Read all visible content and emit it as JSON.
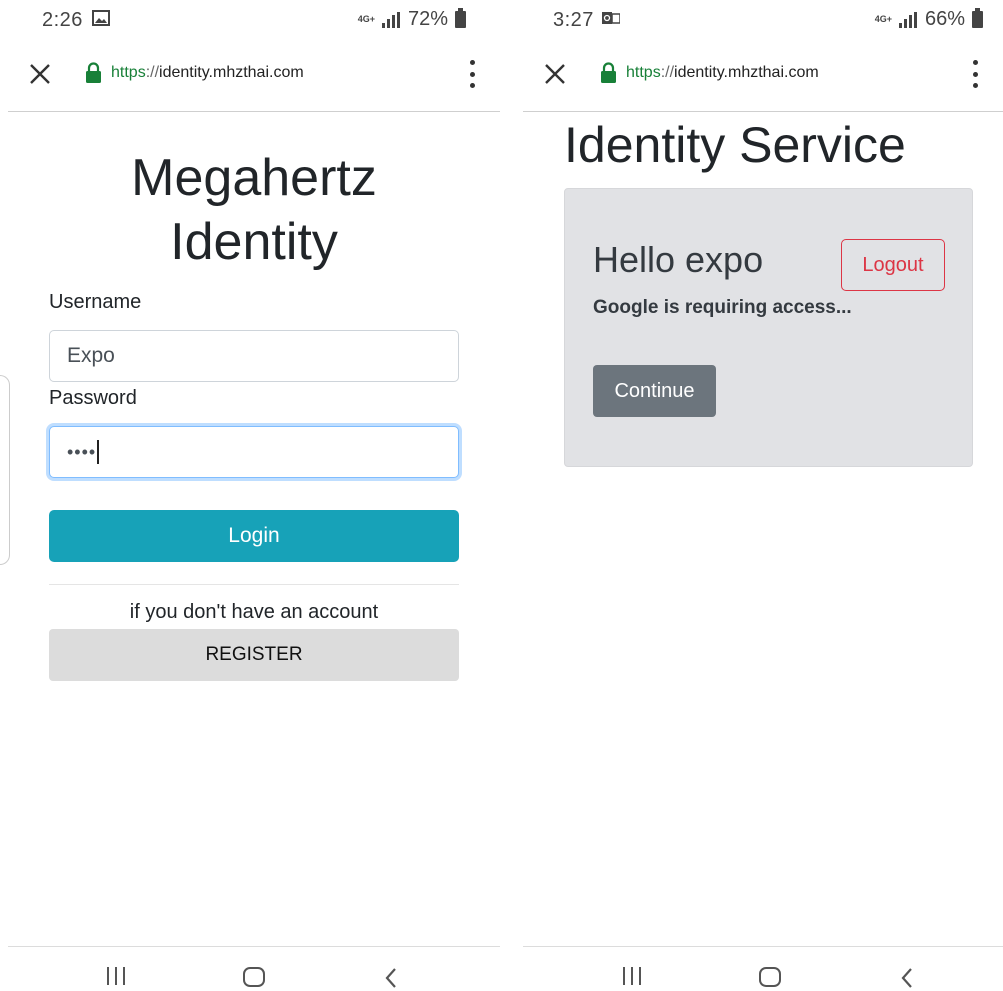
{
  "left": {
    "status": {
      "time": "2:26",
      "network": "4G+",
      "battery": "72%",
      "notification_icon": "image-icon"
    },
    "browser": {
      "url_scheme": "https",
      "url_sep": "://",
      "url_host": "identity.mhzthai.com"
    },
    "login": {
      "title_line1": "Megahertz",
      "title_line2": "Identity",
      "username_label": "Username",
      "username_value": "Expo",
      "password_label": "Password",
      "password_value": "••••",
      "login_button": "Login",
      "no_account_text": "if you don't have an account",
      "register_button": "REGISTER"
    }
  },
  "right": {
    "status": {
      "time": "3:27",
      "network": "4G+",
      "battery": "66%",
      "notification_icon": "outlook-icon"
    },
    "browser": {
      "url_scheme": "https",
      "url_sep": "://",
      "url_host": "identity.mhzthai.com"
    },
    "service": {
      "title": "Identity Service",
      "greeting": "Hello expo",
      "logout_button": "Logout",
      "message": "Google is requiring access...",
      "continue_button": "Continue"
    }
  },
  "colors": {
    "login_button": "#17a2b8",
    "register_button": "#dcdcdc",
    "continue_button": "#6c757d",
    "logout_outline": "#dc3545",
    "panel_bg": "#e1e2e5",
    "secure_green": "#188038"
  }
}
